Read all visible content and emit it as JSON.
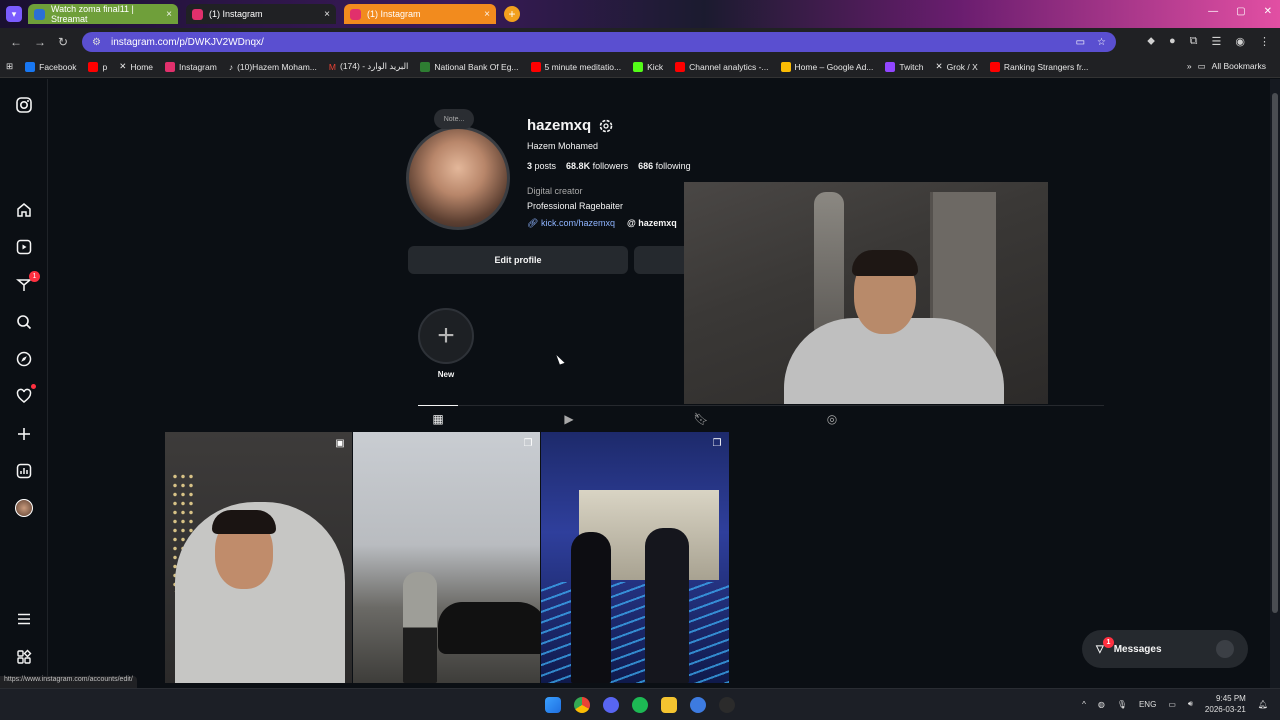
{
  "browser": {
    "tabs": [
      {
        "title": "Watch zoma final11 | Streamat",
        "close": "×"
      },
      {
        "title": "(1) Instagram",
        "close": "×"
      },
      {
        "title": "(1) Instagram",
        "close": "×"
      }
    ],
    "new_tab": "+",
    "url": "instagram.com/p/DWKJV2WDnqx/",
    "bookmarks": [
      {
        "label": "Facebook",
        "color": "#1877f2"
      },
      {
        "label": "p",
        "color": "#ff0000"
      },
      {
        "label": "Home",
        "color": "#ffffff"
      },
      {
        "label": "Instagram",
        "color": "#e1306c"
      },
      {
        "label": "(10)Hazem Moham...",
        "color": "#ffffff"
      },
      {
        "label": "(174) - البريد الوارد",
        "color": "#ea4335"
      },
      {
        "label": "National Bank Of Eg...",
        "color": "#2e7d32"
      },
      {
        "label": "5 minute meditatio...",
        "color": "#ff0000"
      },
      {
        "label": "Kick",
        "color": "#53fc18"
      },
      {
        "label": "Channel analytics -...",
        "color": "#ff0000"
      },
      {
        "label": "Home – Google Ad...",
        "color": "#fbbc04"
      },
      {
        "label": "Twitch",
        "color": "#9146ff"
      },
      {
        "label": "Grok / X",
        "color": "#ffffff"
      },
      {
        "label": "Ranking Strangers fr...",
        "color": "#ff0000"
      }
    ],
    "all_bookmarks": "All Bookmarks"
  },
  "sidebar": {
    "notifications_badge": "1"
  },
  "profile": {
    "note": "Note...",
    "username": "hazemxq",
    "full_name": "Hazem Mohamed",
    "posts_count": "3",
    "posts_label": "posts",
    "followers_count": "68.8K",
    "followers_label": "followers",
    "following_count": "686",
    "following_label": "following",
    "category": "Digital creator",
    "bio": "Professional Ragebaiter",
    "link": "kick.com/hazemxq",
    "threads": "hazemxq",
    "edit_button": "Edit profile",
    "highlight_label": "New"
  },
  "messages": {
    "label": "Messages",
    "badge": "1"
  },
  "status_url": "https://www.instagram.com/accounts/edit/",
  "taskbar": {
    "lang": "ENG",
    "time": "9:45 PM",
    "date": "2026-03-21"
  }
}
